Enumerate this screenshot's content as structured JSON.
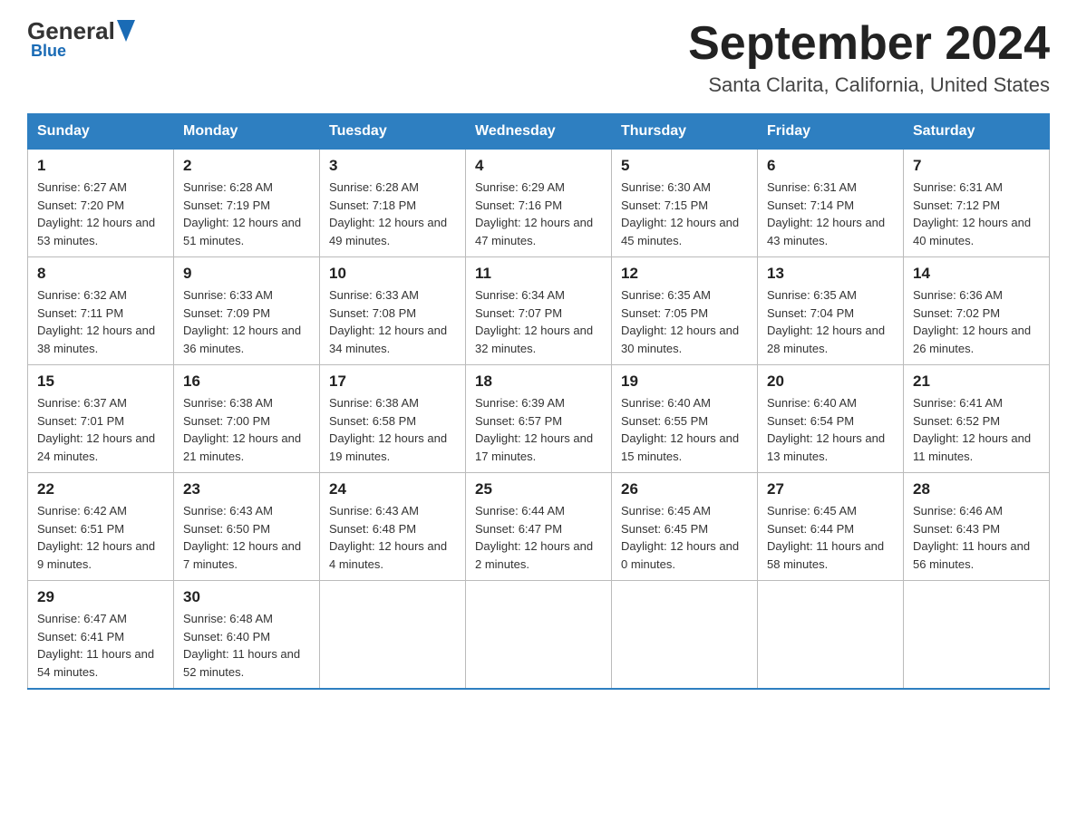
{
  "logo": {
    "general": "General",
    "blue": "Blue",
    "subtitle": "Blue"
  },
  "header": {
    "month": "September 2024",
    "location": "Santa Clarita, California, United States"
  },
  "days_of_week": [
    "Sunday",
    "Monday",
    "Tuesday",
    "Wednesday",
    "Thursday",
    "Friday",
    "Saturday"
  ],
  "weeks": [
    [
      {
        "day": "1",
        "sunrise": "Sunrise: 6:27 AM",
        "sunset": "Sunset: 7:20 PM",
        "daylight": "Daylight: 12 hours and 53 minutes."
      },
      {
        "day": "2",
        "sunrise": "Sunrise: 6:28 AM",
        "sunset": "Sunset: 7:19 PM",
        "daylight": "Daylight: 12 hours and 51 minutes."
      },
      {
        "day": "3",
        "sunrise": "Sunrise: 6:28 AM",
        "sunset": "Sunset: 7:18 PM",
        "daylight": "Daylight: 12 hours and 49 minutes."
      },
      {
        "day": "4",
        "sunrise": "Sunrise: 6:29 AM",
        "sunset": "Sunset: 7:16 PM",
        "daylight": "Daylight: 12 hours and 47 minutes."
      },
      {
        "day": "5",
        "sunrise": "Sunrise: 6:30 AM",
        "sunset": "Sunset: 7:15 PM",
        "daylight": "Daylight: 12 hours and 45 minutes."
      },
      {
        "day": "6",
        "sunrise": "Sunrise: 6:31 AM",
        "sunset": "Sunset: 7:14 PM",
        "daylight": "Daylight: 12 hours and 43 minutes."
      },
      {
        "day": "7",
        "sunrise": "Sunrise: 6:31 AM",
        "sunset": "Sunset: 7:12 PM",
        "daylight": "Daylight: 12 hours and 40 minutes."
      }
    ],
    [
      {
        "day": "8",
        "sunrise": "Sunrise: 6:32 AM",
        "sunset": "Sunset: 7:11 PM",
        "daylight": "Daylight: 12 hours and 38 minutes."
      },
      {
        "day": "9",
        "sunrise": "Sunrise: 6:33 AM",
        "sunset": "Sunset: 7:09 PM",
        "daylight": "Daylight: 12 hours and 36 minutes."
      },
      {
        "day": "10",
        "sunrise": "Sunrise: 6:33 AM",
        "sunset": "Sunset: 7:08 PM",
        "daylight": "Daylight: 12 hours and 34 minutes."
      },
      {
        "day": "11",
        "sunrise": "Sunrise: 6:34 AM",
        "sunset": "Sunset: 7:07 PM",
        "daylight": "Daylight: 12 hours and 32 minutes."
      },
      {
        "day": "12",
        "sunrise": "Sunrise: 6:35 AM",
        "sunset": "Sunset: 7:05 PM",
        "daylight": "Daylight: 12 hours and 30 minutes."
      },
      {
        "day": "13",
        "sunrise": "Sunrise: 6:35 AM",
        "sunset": "Sunset: 7:04 PM",
        "daylight": "Daylight: 12 hours and 28 minutes."
      },
      {
        "day": "14",
        "sunrise": "Sunrise: 6:36 AM",
        "sunset": "Sunset: 7:02 PM",
        "daylight": "Daylight: 12 hours and 26 minutes."
      }
    ],
    [
      {
        "day": "15",
        "sunrise": "Sunrise: 6:37 AM",
        "sunset": "Sunset: 7:01 PM",
        "daylight": "Daylight: 12 hours and 24 minutes."
      },
      {
        "day": "16",
        "sunrise": "Sunrise: 6:38 AM",
        "sunset": "Sunset: 7:00 PM",
        "daylight": "Daylight: 12 hours and 21 minutes."
      },
      {
        "day": "17",
        "sunrise": "Sunrise: 6:38 AM",
        "sunset": "Sunset: 6:58 PM",
        "daylight": "Daylight: 12 hours and 19 minutes."
      },
      {
        "day": "18",
        "sunrise": "Sunrise: 6:39 AM",
        "sunset": "Sunset: 6:57 PM",
        "daylight": "Daylight: 12 hours and 17 minutes."
      },
      {
        "day": "19",
        "sunrise": "Sunrise: 6:40 AM",
        "sunset": "Sunset: 6:55 PM",
        "daylight": "Daylight: 12 hours and 15 minutes."
      },
      {
        "day": "20",
        "sunrise": "Sunrise: 6:40 AM",
        "sunset": "Sunset: 6:54 PM",
        "daylight": "Daylight: 12 hours and 13 minutes."
      },
      {
        "day": "21",
        "sunrise": "Sunrise: 6:41 AM",
        "sunset": "Sunset: 6:52 PM",
        "daylight": "Daylight: 12 hours and 11 minutes."
      }
    ],
    [
      {
        "day": "22",
        "sunrise": "Sunrise: 6:42 AM",
        "sunset": "Sunset: 6:51 PM",
        "daylight": "Daylight: 12 hours and 9 minutes."
      },
      {
        "day": "23",
        "sunrise": "Sunrise: 6:43 AM",
        "sunset": "Sunset: 6:50 PM",
        "daylight": "Daylight: 12 hours and 7 minutes."
      },
      {
        "day": "24",
        "sunrise": "Sunrise: 6:43 AM",
        "sunset": "Sunset: 6:48 PM",
        "daylight": "Daylight: 12 hours and 4 minutes."
      },
      {
        "day": "25",
        "sunrise": "Sunrise: 6:44 AM",
        "sunset": "Sunset: 6:47 PM",
        "daylight": "Daylight: 12 hours and 2 minutes."
      },
      {
        "day": "26",
        "sunrise": "Sunrise: 6:45 AM",
        "sunset": "Sunset: 6:45 PM",
        "daylight": "Daylight: 12 hours and 0 minutes."
      },
      {
        "day": "27",
        "sunrise": "Sunrise: 6:45 AM",
        "sunset": "Sunset: 6:44 PM",
        "daylight": "Daylight: 11 hours and 58 minutes."
      },
      {
        "day": "28",
        "sunrise": "Sunrise: 6:46 AM",
        "sunset": "Sunset: 6:43 PM",
        "daylight": "Daylight: 11 hours and 56 minutes."
      }
    ],
    [
      {
        "day": "29",
        "sunrise": "Sunrise: 6:47 AM",
        "sunset": "Sunset: 6:41 PM",
        "daylight": "Daylight: 11 hours and 54 minutes."
      },
      {
        "day": "30",
        "sunrise": "Sunrise: 6:48 AM",
        "sunset": "Sunset: 6:40 PM",
        "daylight": "Daylight: 11 hours and 52 minutes."
      },
      null,
      null,
      null,
      null,
      null
    ]
  ]
}
